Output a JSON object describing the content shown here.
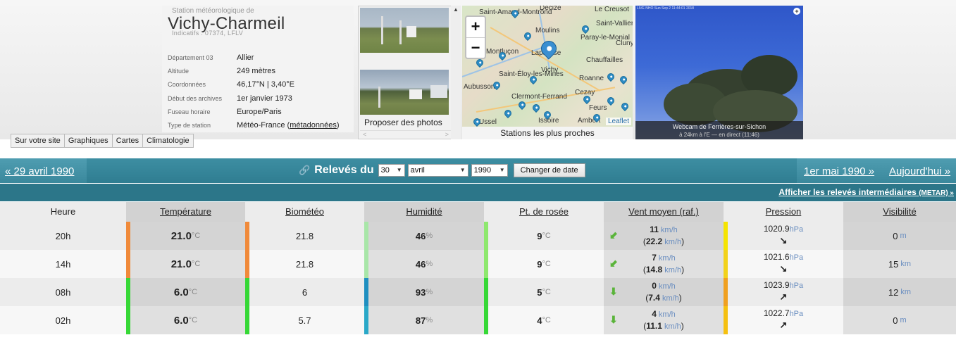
{
  "station": {
    "subtitle": "Station météorologique de",
    "name": "Vichy-Charmeil",
    "codes": "Indicatifs : 07374, LFLV",
    "info": [
      {
        "label": "Département 03",
        "value": "Allier"
      },
      {
        "label": "Altitude",
        "value": "249 mètres"
      },
      {
        "label": "Coordonnées",
        "value": "46,17°N | 3,40°E"
      },
      {
        "label": "Début des archives",
        "value": "1er janvier 1973"
      },
      {
        "label": "Fuseau horaire",
        "value": "Europe/Paris"
      },
      {
        "label": "Type de station",
        "value": "Météo-France",
        "link": "métadonnées"
      }
    ]
  },
  "photos": {
    "propose_label": "Proposer des photos",
    "scroll_left": "<",
    "scroll_right": ">"
  },
  "map": {
    "zoom_in": "+",
    "zoom_out": "−",
    "attribution": "Leaflet",
    "caption": "Stations les plus proches",
    "places": [
      "Saint-Amand-Montrond",
      "Decize",
      "Le Creusot",
      "Saint-Vallier",
      "Moulins",
      "Paray-le-Monial",
      "Cluny",
      "Montluçon",
      "Lapalisse",
      "Chauffailles",
      "Vichy",
      "Saint-Éloy-les-Mines",
      "Roanne",
      "Aubusson",
      "Cezay",
      "Clermont-Ferrand",
      "Feurs",
      "Issoire",
      "Ambert",
      "Ussel"
    ]
  },
  "webcam": {
    "overlay": "LIVE NHO Sun Sep 2 11:44:01 2018",
    "title": "Webcam de Ferrières-sur-Sichon",
    "subtitle": "à 24km à l'E — en direct (11:46)"
  },
  "tabs": [
    "Sur votre site",
    "Graphiques",
    "Cartes",
    "Climatologie"
  ],
  "datebar": {
    "prev": "« 29 avril 1990",
    "label": "Relevés du",
    "day": "30",
    "month": "avril",
    "year": "1990",
    "change_button": "Changer de date",
    "next": "1er mai 1990 »",
    "today": "Aujourd'hui »"
  },
  "metar_link": {
    "text": "Afficher les relevés intermédiaires",
    "small": "(METAR) »"
  },
  "columns": [
    "Heure",
    "Température",
    "Biométéo",
    "Humidité",
    "Pt. de rosée",
    "Vent moyen (raf.)",
    "Pression",
    "Visibilité"
  ],
  "colors": {
    "header_teal": "#2f7d91",
    "row_marker": "#b71c1c"
  },
  "rows": [
    {
      "hour": "20h",
      "temp": "21.0",
      "temp_color": "#f08a3a",
      "bio": "21.8",
      "bio_color": "#f08a3a",
      "hum": "46",
      "hum_color": "#a8e6a8",
      "dew": "9",
      "dew_color": "#8ee86e",
      "wind": "11",
      "gust": "22.2",
      "wind_arrow": "⬋",
      "press": "1020.9",
      "press_arrow": "↘",
      "press_color": "#f5e400",
      "vis": "0",
      "vis_unit": "m"
    },
    {
      "hour": "14h",
      "temp": "21.0",
      "temp_color": "#f08a3a",
      "bio": "21.8",
      "bio_color": "#f08a3a",
      "hum": "46",
      "hum_color": "#a8e6a8",
      "dew": "9",
      "dew_color": "#8ee86e",
      "wind": "7",
      "gust": "14.8",
      "wind_arrow": "⬋",
      "press": "1021.6",
      "press_arrow": "↘",
      "press_color": "#f2d21a",
      "vis": "15",
      "vis_unit": "km"
    },
    {
      "hour": "08h",
      "temp": "6.0",
      "temp_color": "#36d836",
      "bio": "6",
      "bio_color": "#36d836",
      "hum": "93",
      "hum_color": "#1f8fc0",
      "dew": "5",
      "dew_color": "#36d836",
      "wind": "0",
      "gust": "7.4",
      "wind_arrow": "⬇",
      "press": "1023.9",
      "press_arrow": "↗",
      "press_color": "#f0a020",
      "vis": "12",
      "vis_unit": "km"
    },
    {
      "hour": "02h",
      "temp": "6.0",
      "temp_color": "#36d836",
      "bio": "5.7",
      "bio_color": "#36d836",
      "hum": "87",
      "hum_color": "#2aa8c8",
      "dew": "4",
      "dew_color": "#36d836",
      "wind": "4",
      "gust": "11.1",
      "wind_arrow": "⬇",
      "press": "1022.7",
      "press_arrow": "↗",
      "press_color": "#f5c010",
      "vis": "0",
      "vis_unit": "m"
    }
  ]
}
